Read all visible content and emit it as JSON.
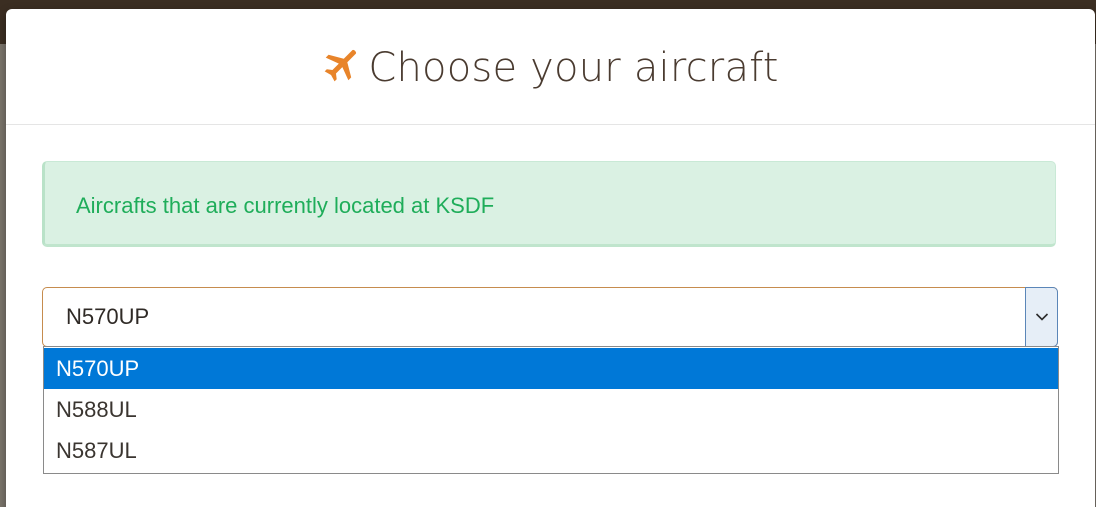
{
  "modal": {
    "title": "Choose your aircraft",
    "icon": "plane-icon",
    "accent_color": "#e8842a"
  },
  "alert": {
    "text": "Aircrafts that are currently located at KSDF",
    "text_color": "#1fad5a",
    "background": "#daf1e3"
  },
  "aircraft_select": {
    "selected_value": "N570UP",
    "arrow_icon": "chevron-down-icon",
    "options": [
      {
        "label": "N570UP",
        "selected": true
      },
      {
        "label": "N588UL",
        "selected": false
      },
      {
        "label": "N587UL",
        "selected": false
      }
    ],
    "highlight_color": "#0078d7"
  }
}
